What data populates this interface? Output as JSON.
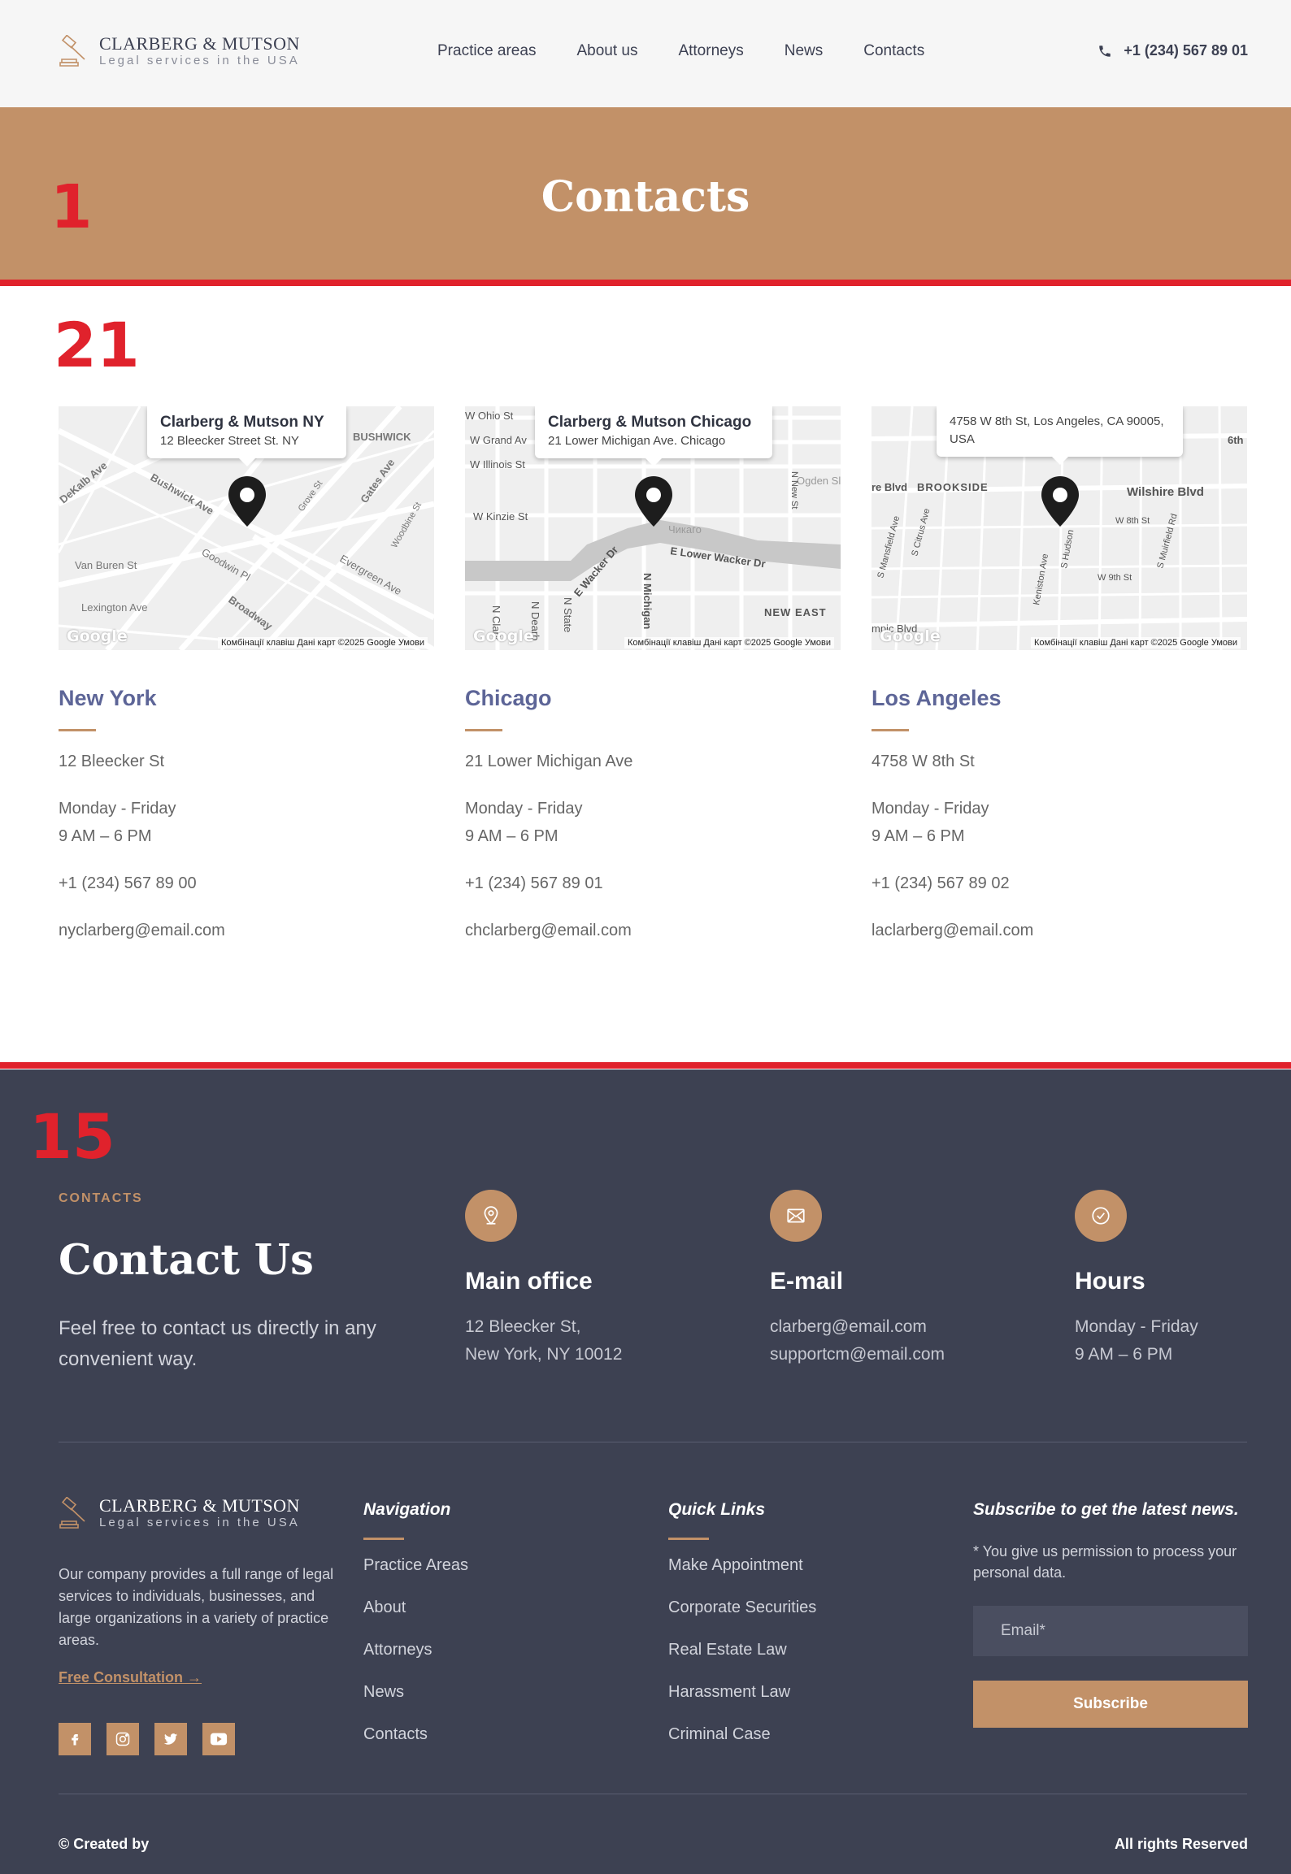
{
  "brand": {
    "name": "CLARBERG & MUTSON",
    "tagline": "Legal services in the USA"
  },
  "nav": {
    "items": [
      "Practice areas",
      "About us",
      "Attorneys",
      "News",
      "Contacts"
    ]
  },
  "header": {
    "phone": "+1 (234) 567 89 01"
  },
  "hero": {
    "title": "Contacts"
  },
  "markers": {
    "hero": "1",
    "offices": "21",
    "footer": "15"
  },
  "map": {
    "google_label": "Google",
    "footer_text": "Комбінації клавіш   Дані карт ©2025 Google   Умови"
  },
  "offices": [
    {
      "card_title": "Clarberg & Mutson NY",
      "card_address": "12 Bleecker Street St. NY",
      "map_labels": [
        "BUSHWICK",
        "Bushwick Ave",
        "DeKalb Ave",
        "Gates Ave",
        "Van Buren St",
        "Goodwin Pl",
        "Evergreen Ave",
        "Lexington Ave",
        "Broadway",
        "Grove St",
        "Woodbine St"
      ],
      "city": "New York",
      "address": "12 Bleecker St",
      "days": "Monday - Friday",
      "hours": "9 AM – 6 PM",
      "phone": "+1 (234) 567 89 00",
      "email": "nyclarberg@email.com"
    },
    {
      "card_title": "Clarberg & Mutson Chicago",
      "card_address": "21 Lower Michigan Ave. Chicago",
      "map_labels": [
        "W Ohio St",
        "W Grand Av",
        "W Illinois St",
        "W Kinzie St",
        "E Lower Wacker Dr",
        "Чикаго",
        "E Wacker Dr",
        "N Michigan",
        "NEW EAST",
        "N State",
        "N Dearb",
        "N Clark",
        "Ogden Sl",
        "N New St"
      ],
      "city": "Chicago",
      "address": "21 Lower Michigan Ave",
      "days": "Monday - Friday",
      "hours": "9 AM – 6 PM",
      "phone": "+1 (234) 567 89 01",
      "email": "chclarberg@email.com"
    },
    {
      "card_title": "",
      "card_address": "4758 W 8th St, Los Angeles, CA 90005, USA",
      "map_labels": [
        "BROOKSIDE",
        "Wilshire Blvd",
        "re Blvd",
        "W 8th St",
        "W 9th St",
        "S Mansfield Ave",
        "S Citrus Ave",
        "Keniston Ave",
        "S Hudson",
        "S Muirfield Rd",
        "6th",
        "mpic Blvd"
      ],
      "city": "Los Angeles",
      "address": "4758 W 8th St",
      "days": "Monday - Friday",
      "hours": "9 AM – 6 PM",
      "phone": "+1 (234) 567 89 02",
      "email": "laclarberg@email.com"
    }
  ],
  "contact": {
    "kicker": "CONTACTS",
    "title": "Contact Us",
    "lead": "Feel free to contact us directly in any convenient way.",
    "main_office": {
      "title": "Main office",
      "line1": "12 Bleecker St,",
      "line2": "New York, NY 10012",
      "icon": "location-pin-icon"
    },
    "email": {
      "title": "E-mail",
      "line1": "clarberg@email.com",
      "line2": "supportcm@email.com",
      "icon": "envelope-icon"
    },
    "hours": {
      "title": "Hours",
      "line1": "Monday - Friday",
      "line2": "9 AM – 6 PM",
      "icon": "clock-check-icon"
    }
  },
  "footer": {
    "about": "Our company provides a full range of legal services to individuals, businesses, and large organizations in a variety of practice areas.",
    "consultation": "Free Consultation →",
    "navigation": {
      "title": "Navigation",
      "links": [
        "Practice Areas",
        "About",
        "Attorneys",
        "News",
        "Contacts"
      ]
    },
    "quick_links": {
      "title": "Quick Links",
      "links": [
        "Make Appointment",
        "Corporate Securities",
        "Real Estate Law",
        "Harassment Law",
        "Criminal Case"
      ]
    },
    "subscribe": {
      "title": "Subscribe to get the latest news.",
      "note": "* You give us permission to process your personal data.",
      "placeholder": "Email*",
      "button": "Subscribe"
    },
    "created_by": "© Created by",
    "rights": "All rights Reserved"
  },
  "colors": {
    "accent": "#c29168",
    "dark": "#3d4152",
    "city": "#5d6597",
    "marker": "#e0222c"
  }
}
